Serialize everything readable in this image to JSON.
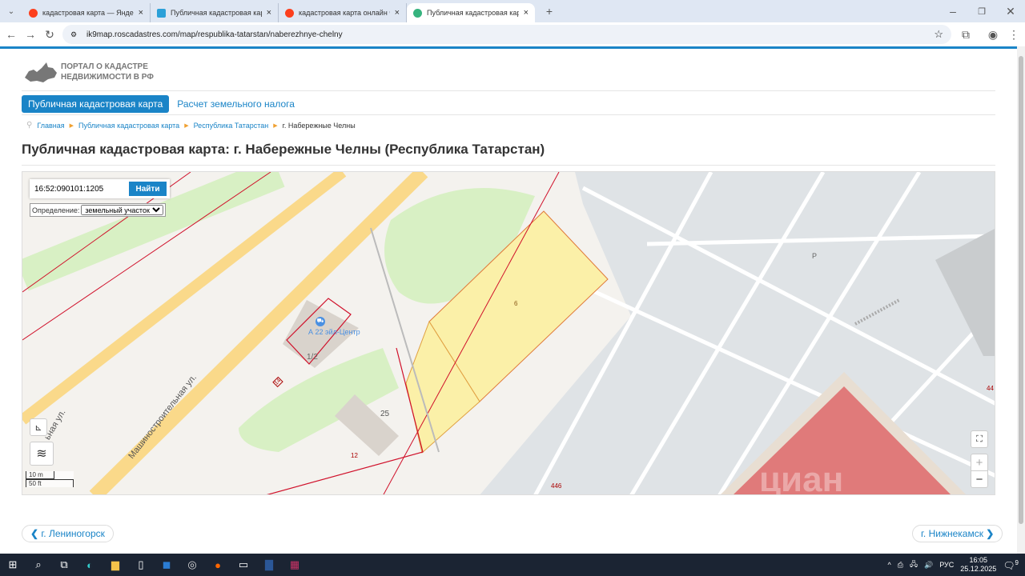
{
  "browser": {
    "tabs": [
      {
        "title": "кадастровая карта — Яндекс",
        "color": "#fc3f1d"
      },
      {
        "title": "Публичная кадастровая карта",
        "color": "#2ba0d8"
      },
      {
        "title": "кадастровая карта онлайн че",
        "color": "#fc3f1d"
      },
      {
        "title": "Публичная кадастровая карта",
        "color": "#36b37e",
        "active": true
      }
    ],
    "url": "ik9map.roscadastres.com/map/respublika-tatarstan/naberezhnye-chelny"
  },
  "logo": {
    "line1": "ПОРТАЛ О КАДАСТРЕ",
    "line2": "НЕДВИЖИМОСТИ В РФ"
  },
  "menu": {
    "active": "Публичная кадастровая карта",
    "tax": "Расчет земельного налога"
  },
  "breadcrumb": [
    "Главная",
    "Публичная кадастровая карта",
    "Республика Татарстан",
    "г. Набережные Челны"
  ],
  "title": "Публичная кадастровая карта: г. Набережные Челны (Республика Татарстан)",
  "map": {
    "search_value": "16:52:090101:1205",
    "search_button": "Найти",
    "definition_label": "Определение:",
    "definition_value": "земельный участок",
    "labels": {
      "street": "Машиностроительная ул.",
      "street2": "ьная ул.",
      "parcel6": "6",
      "b25": "25",
      "n12": "12",
      "b12": "1/2",
      "n14": "14",
      "n446": "446",
      "n44": "44",
      "p": "P",
      "poi": "А 22 эйл-Центр"
    },
    "scale": {
      "m": "10 m",
      "ft": "50 ft"
    },
    "zoom_in": "+",
    "zoom_out": "−",
    "watermark": "циан"
  },
  "pager": {
    "prev": "г. Лениногорск",
    "next": "г. Нижнекамск"
  },
  "taskbar": {
    "lang": "РУС",
    "time": "16:05",
    "date": "25.12.2025",
    "notifications": "9"
  }
}
